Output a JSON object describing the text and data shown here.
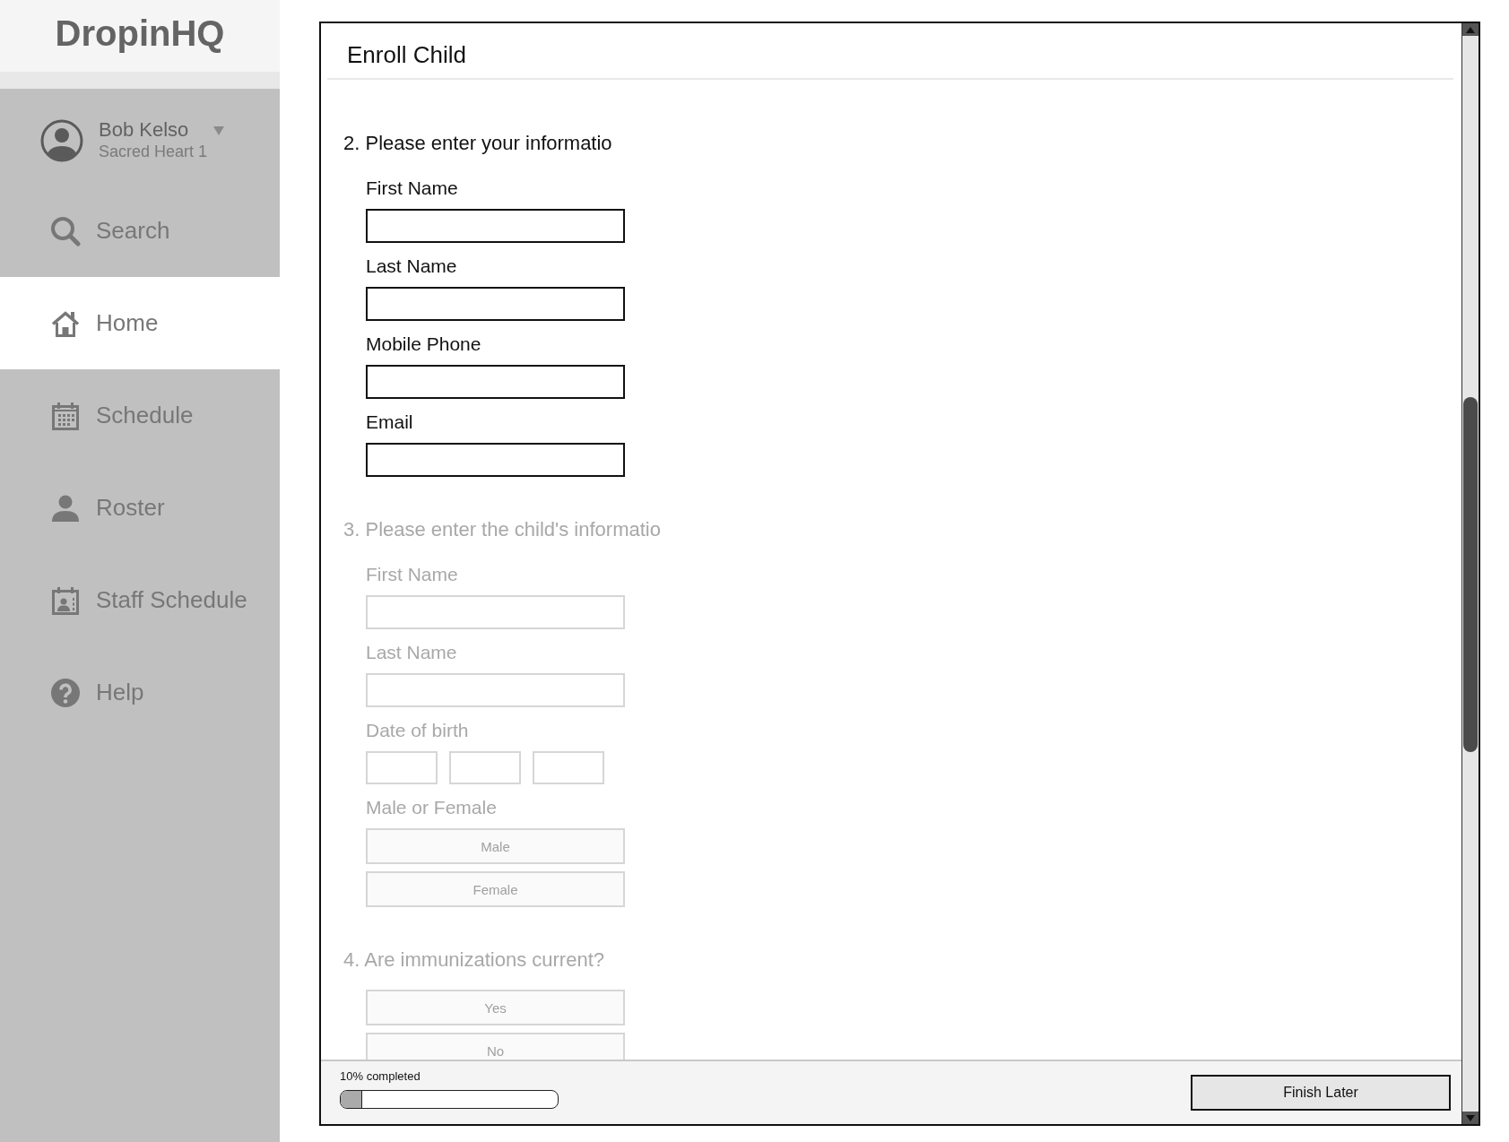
{
  "sidebar": {
    "logo": "DropinHQ",
    "user": {
      "name": "Bob Kelso",
      "organization": "Sacred Heart 1"
    },
    "items": [
      {
        "label": "Search",
        "selected": false
      },
      {
        "label": "Home",
        "selected": true
      },
      {
        "label": "Schedule",
        "selected": false
      },
      {
        "label": "Roster",
        "selected": false
      },
      {
        "label": "Staff Schedule",
        "selected": false
      },
      {
        "label": "Help",
        "selected": false
      }
    ]
  },
  "form": {
    "title": "Enroll Child",
    "sections": [
      {
        "heading": "2. Please enter your informatio",
        "disabled": false,
        "fields": [
          {
            "kind": "text",
            "label": "First Name"
          },
          {
            "kind": "text",
            "label": "Last Name"
          },
          {
            "kind": "text",
            "label": "Mobile Phone"
          },
          {
            "kind": "text",
            "label": "Email"
          }
        ]
      },
      {
        "heading": "3. Please enter the child's informatio",
        "disabled": true,
        "fields": [
          {
            "kind": "text",
            "label": "First Name"
          },
          {
            "kind": "text",
            "label": "Last Name"
          },
          {
            "kind": "date",
            "label": "Date of birth"
          },
          {
            "kind": "choice",
            "label": "Male or Female",
            "options": [
              "Male",
              "Female"
            ]
          }
        ]
      },
      {
        "heading": "4. Are immunizations current?",
        "disabled": true,
        "fields": [
          {
            "kind": "choice",
            "options": [
              "Yes",
              "No"
            ]
          }
        ]
      }
    ]
  },
  "footer": {
    "progress": {
      "label": "10% completed",
      "level": 0.1
    },
    "button": "Finish Later"
  }
}
